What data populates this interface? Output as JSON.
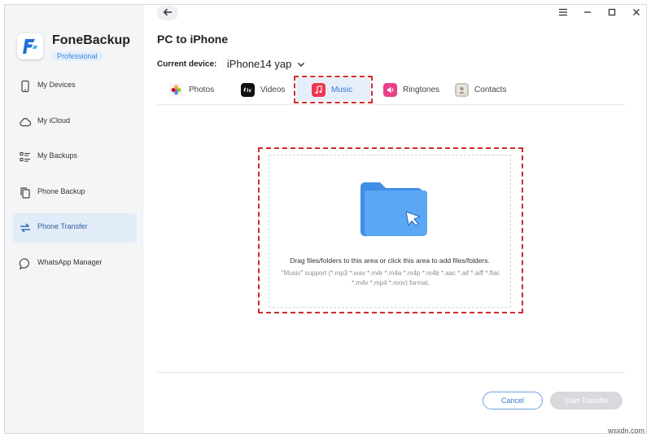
{
  "app": {
    "name": "FoneBackup",
    "edition": "Professional",
    "accent": "#3a78d4"
  },
  "sidebar": {
    "items": [
      {
        "label": "My Devices",
        "icon": "phone-icon"
      },
      {
        "label": "My iCloud",
        "icon": "cloud-icon"
      },
      {
        "label": "My Backups",
        "icon": "list-icon"
      },
      {
        "label": "Phone Backup",
        "icon": "copy-icon"
      },
      {
        "label": "Phone Transfer",
        "icon": "transfer-icon",
        "active": true
      },
      {
        "label": "WhatsApp Manager",
        "icon": "chat-bubble-icon"
      }
    ]
  },
  "page": {
    "title": "PC to iPhone",
    "device_label": "Current device:",
    "device_name": "iPhone14 yap"
  },
  "tabs": [
    {
      "label": "Photos",
      "icon": "photos-icon"
    },
    {
      "label": "Videos",
      "icon": "appletv-icon"
    },
    {
      "label": "Music",
      "icon": "music-icon",
      "selected": true
    },
    {
      "label": "Ringtones",
      "icon": "ringtones-icon"
    },
    {
      "label": "Contacts",
      "icon": "contacts-icon"
    }
  ],
  "drop_area": {
    "main_text": "Drag files/folders to this area or click this area to add files/folders.",
    "support_text": "\"Music\" support (*.mp3 *.wav *.m4r *.m4a *.m4p *.m4b *.aac *.aif *.aiff *.flac *.m4v *.mp4 *.mov) format."
  },
  "footer": {
    "cancel_label": "Cancel",
    "start_label": "Start Transfer"
  },
  "watermark": "wsxdn.com"
}
